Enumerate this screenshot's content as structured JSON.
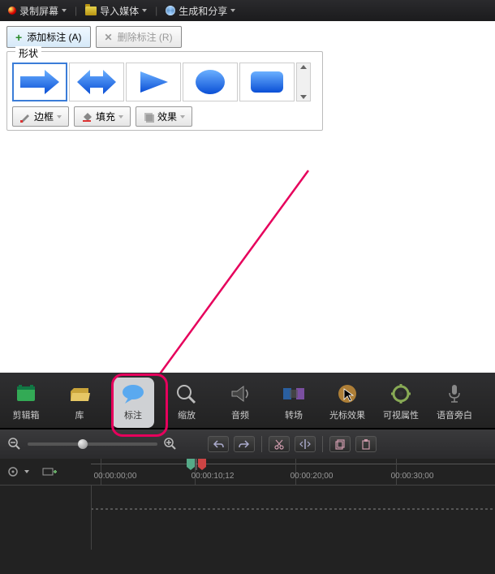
{
  "menu": {
    "record": "录制屏幕",
    "import": "导入媒体",
    "produce": "生成和分享"
  },
  "callout": {
    "add": "添加标注 (A)",
    "remove": "删除标注 (R)",
    "shape_legend": "形状",
    "border": "边框",
    "fill": "填充",
    "effect": "效果"
  },
  "tabs": [
    {
      "key": "clipbin",
      "label": "剪辑箱"
    },
    {
      "key": "library",
      "label": "库"
    },
    {
      "key": "callouts",
      "label": "标注"
    },
    {
      "key": "zoom",
      "label": "缩放"
    },
    {
      "key": "audio",
      "label": "音频"
    },
    {
      "key": "transitions",
      "label": "转场"
    },
    {
      "key": "cursor",
      "label": "光标效果"
    },
    {
      "key": "visual",
      "label": "可视属性"
    },
    {
      "key": "narration",
      "label": "语音旁白"
    }
  ],
  "timeline": {
    "marks": [
      "00:00:00;00",
      "00:00:10;12",
      "00:00:20;00",
      "00:00:30;00"
    ]
  }
}
